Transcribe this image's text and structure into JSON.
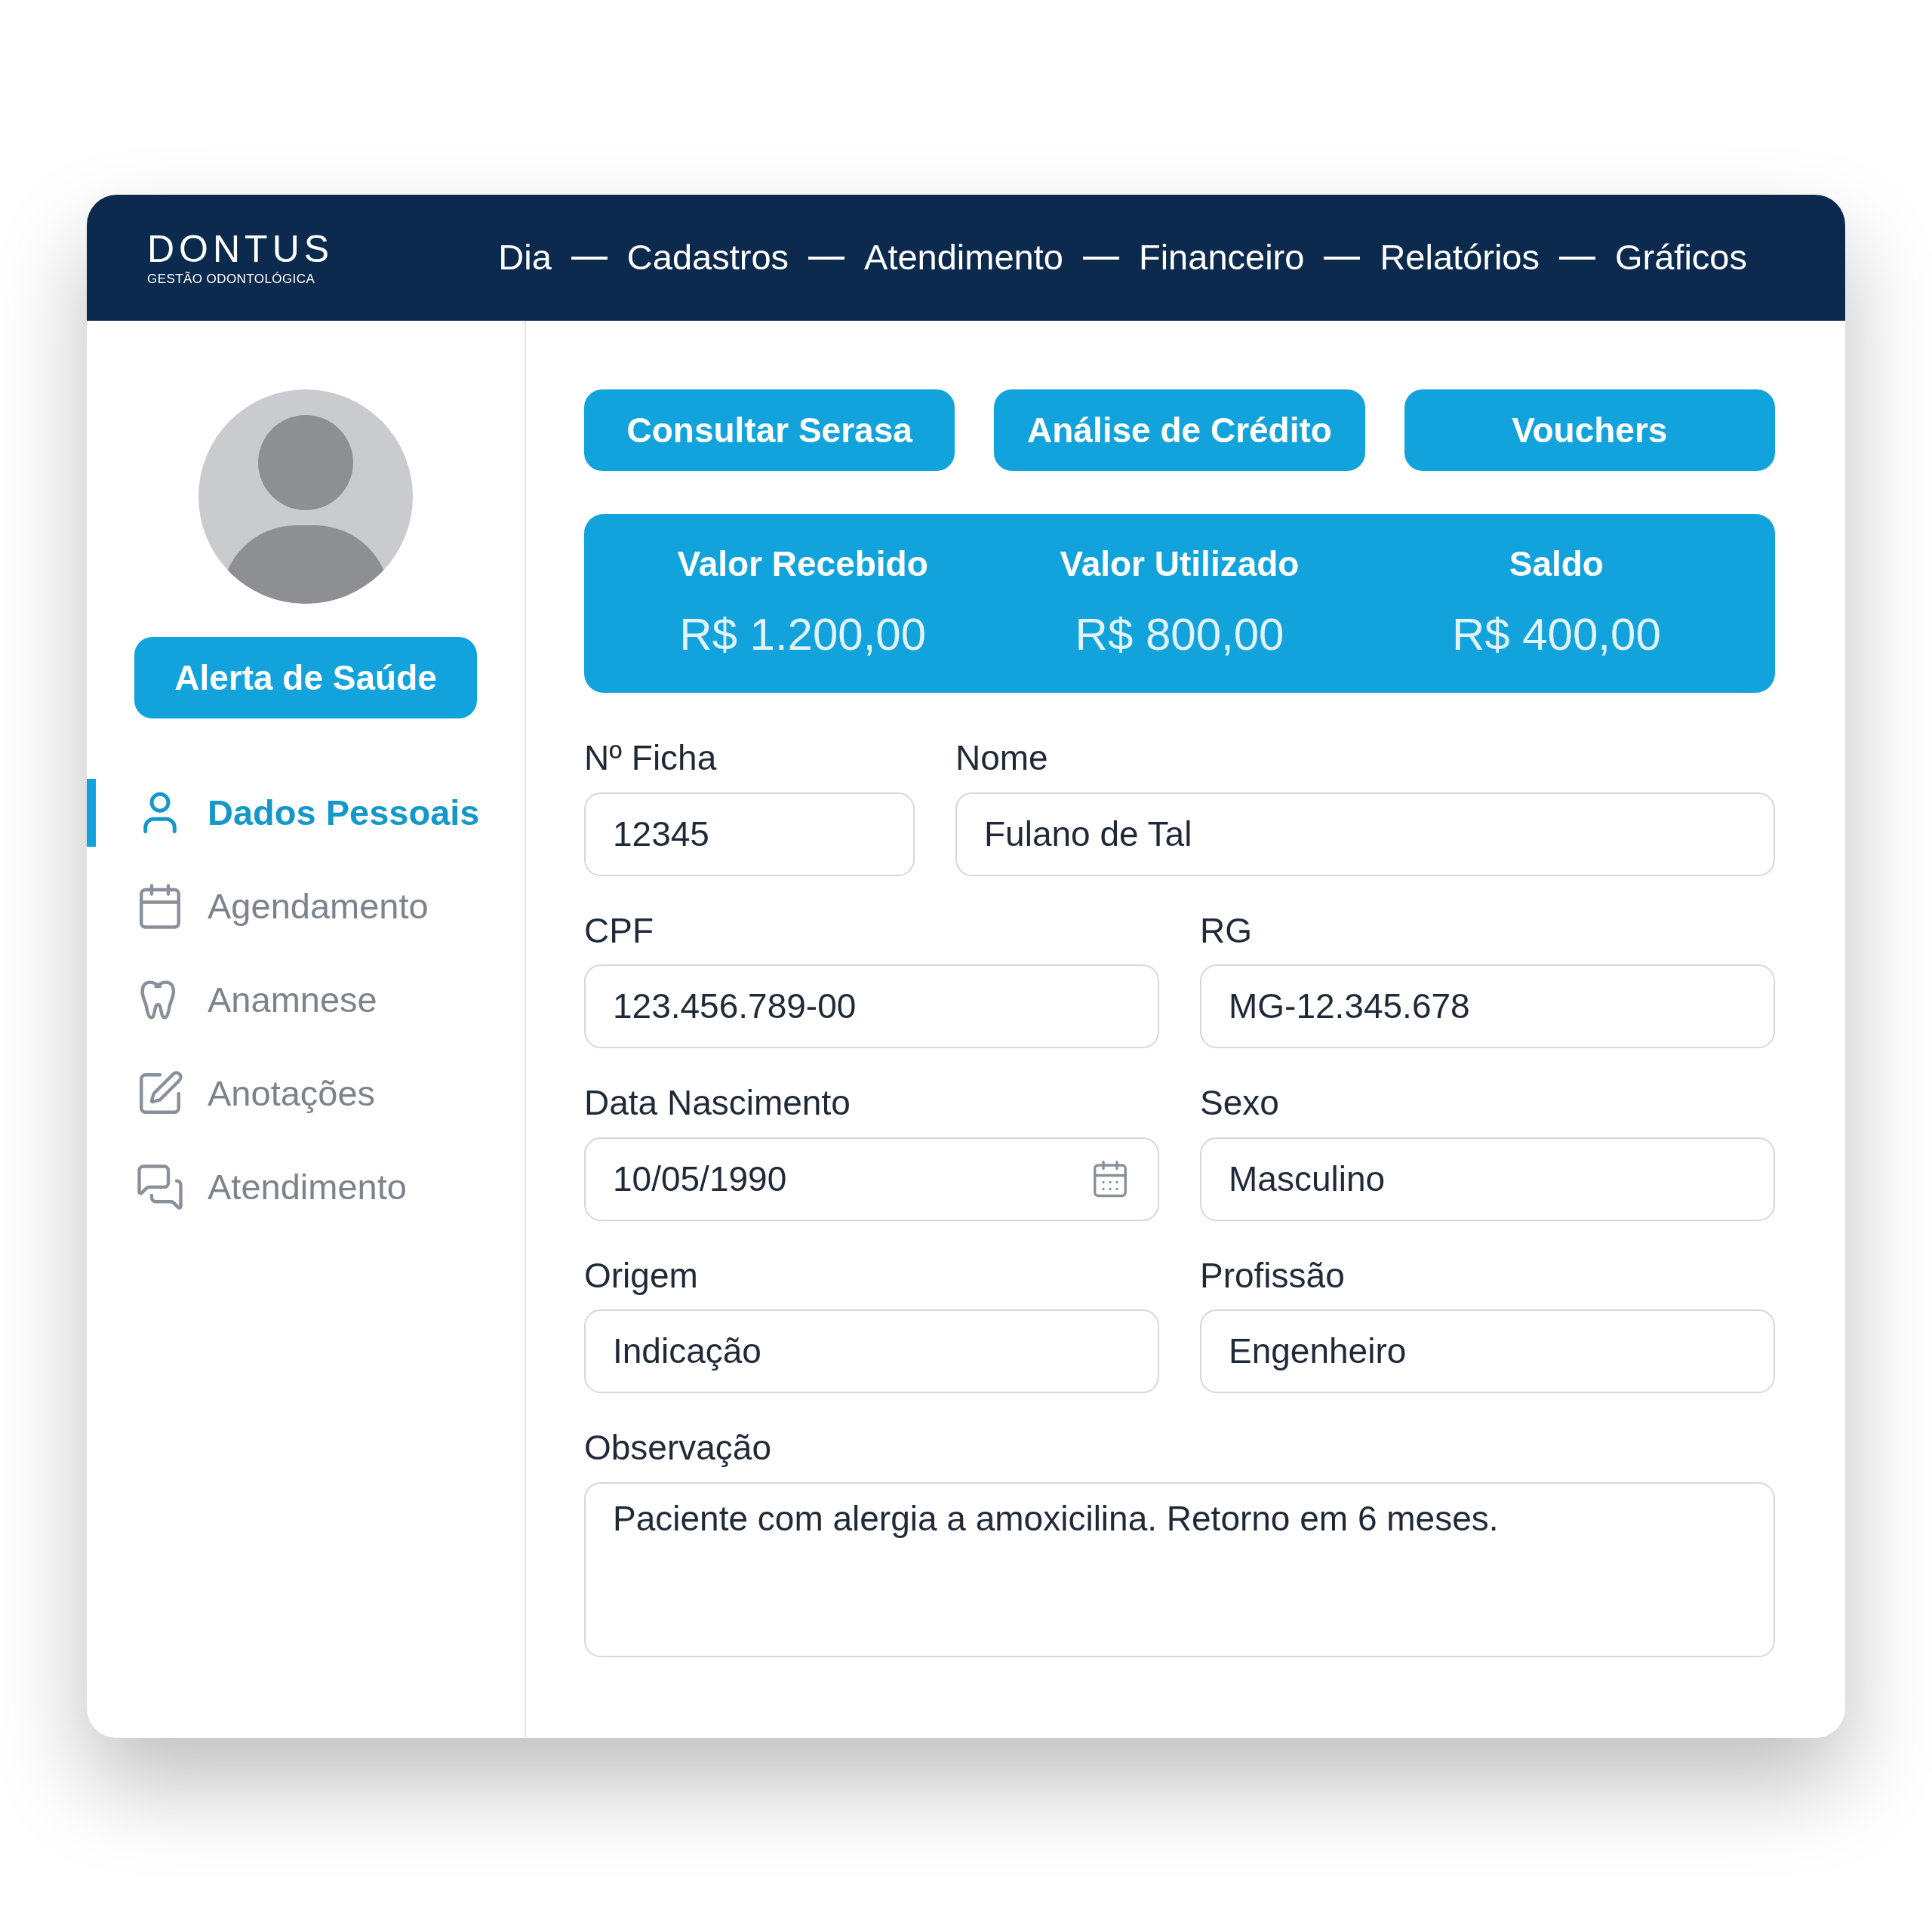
{
  "header": {
    "logo": {
      "name": "DONTUS",
      "tagline": "GESTÃO ODONTOLÓGICA"
    },
    "nav": [
      "Dia",
      "Cadastros",
      "Atendimento",
      "Financeiro",
      "Relatórios",
      "Gráficos"
    ]
  },
  "sidebar": {
    "alert_button": "Alerta de Saúde",
    "items": [
      {
        "label": "Dados Pessoais",
        "selected": true
      },
      {
        "label": "Agendamento",
        "selected": false
      },
      {
        "label": "Anamnese",
        "selected": false
      },
      {
        "label": "Anotações",
        "selected": false
      },
      {
        "label": "Atendimento",
        "selected": false
      }
    ]
  },
  "actions": [
    "Consultar Serasa",
    "Análise de Crédito",
    "Vouchers"
  ],
  "summary": [
    {
      "label": "Valor Recebido",
      "value": "R$ 1.200,00"
    },
    {
      "label": "Valor Utilizado",
      "value": "R$ 800,00"
    },
    {
      "label": "Saldo",
      "value": "R$ 400,00"
    }
  ],
  "form": {
    "rows": [
      [
        {
          "label": "Nº Ficha",
          "value": "12345",
          "kind": "text"
        },
        {
          "label": "Nome",
          "value": "Fulano de Tal",
          "kind": "text"
        }
      ],
      [
        {
          "label": "CPF",
          "value": "123.456.789-00",
          "kind": "text"
        },
        {
          "label": "RG",
          "value": "MG-12.345.678",
          "kind": "text"
        }
      ],
      [
        {
          "label": "Data Nascimento",
          "value": "10/05/1990",
          "kind": "date"
        },
        {
          "label": "Sexo",
          "value": "Masculino",
          "kind": "text"
        }
      ],
      [
        {
          "label": "Origem",
          "value": "Indicação",
          "kind": "text"
        },
        {
          "label": "Profissão",
          "value": "Engenheiro",
          "kind": "text"
        }
      ],
      [
        {
          "label": "Observação",
          "value": "Paciente com alergia a amoxicilina. Retorno em 6 meses.",
          "kind": "textarea"
        }
      ]
    ]
  }
}
